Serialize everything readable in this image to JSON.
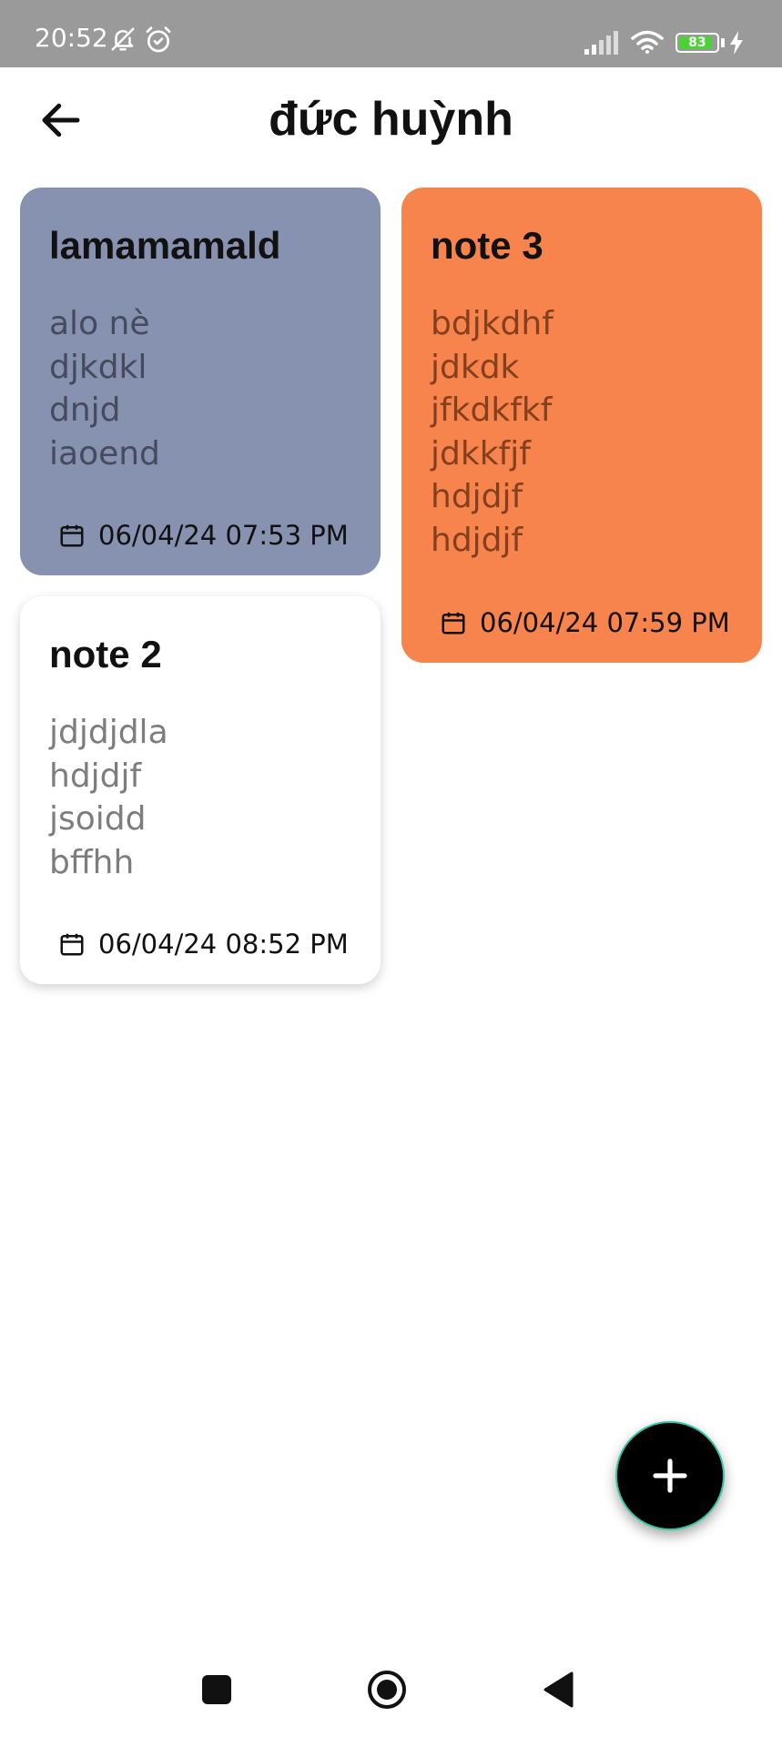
{
  "status_bar": {
    "time": "20:52",
    "battery_level": "83",
    "battery_fraction": 0.83,
    "icons": [
      "mute-bell-icon",
      "alarm-icon",
      "signal-icon",
      "wifi-icon",
      "battery-icon",
      "charging-icon"
    ]
  },
  "header": {
    "title": "đức huỳnh",
    "back_icon": "arrow-left-icon"
  },
  "notes": [
    {
      "title": "lamamamald",
      "body": "alo nè\ndjkdkl\ndnjd\niaoend",
      "date": "06/04/24 07:53 PM",
      "color": "#8791b0"
    },
    {
      "title": "note 3",
      "body": "bdjkdhf\njdkdk\njfkdkfkf\njdkkfjf\nhdjdjf\nhdjdjf",
      "date": "06/04/24 07:59 PM",
      "color": "#f7844c"
    },
    {
      "title": "note 2",
      "body": "jdjdjdla\nhdjdjf\njsoidd\nbffhh",
      "date": "06/04/24 08:52 PM",
      "color": "#ffffff"
    }
  ],
  "fab": {
    "icon": "plus-icon",
    "color": "#000000"
  },
  "nav_bar": {
    "icons": [
      "recents-square-icon",
      "home-circle-icon",
      "back-triangle-icon"
    ]
  }
}
